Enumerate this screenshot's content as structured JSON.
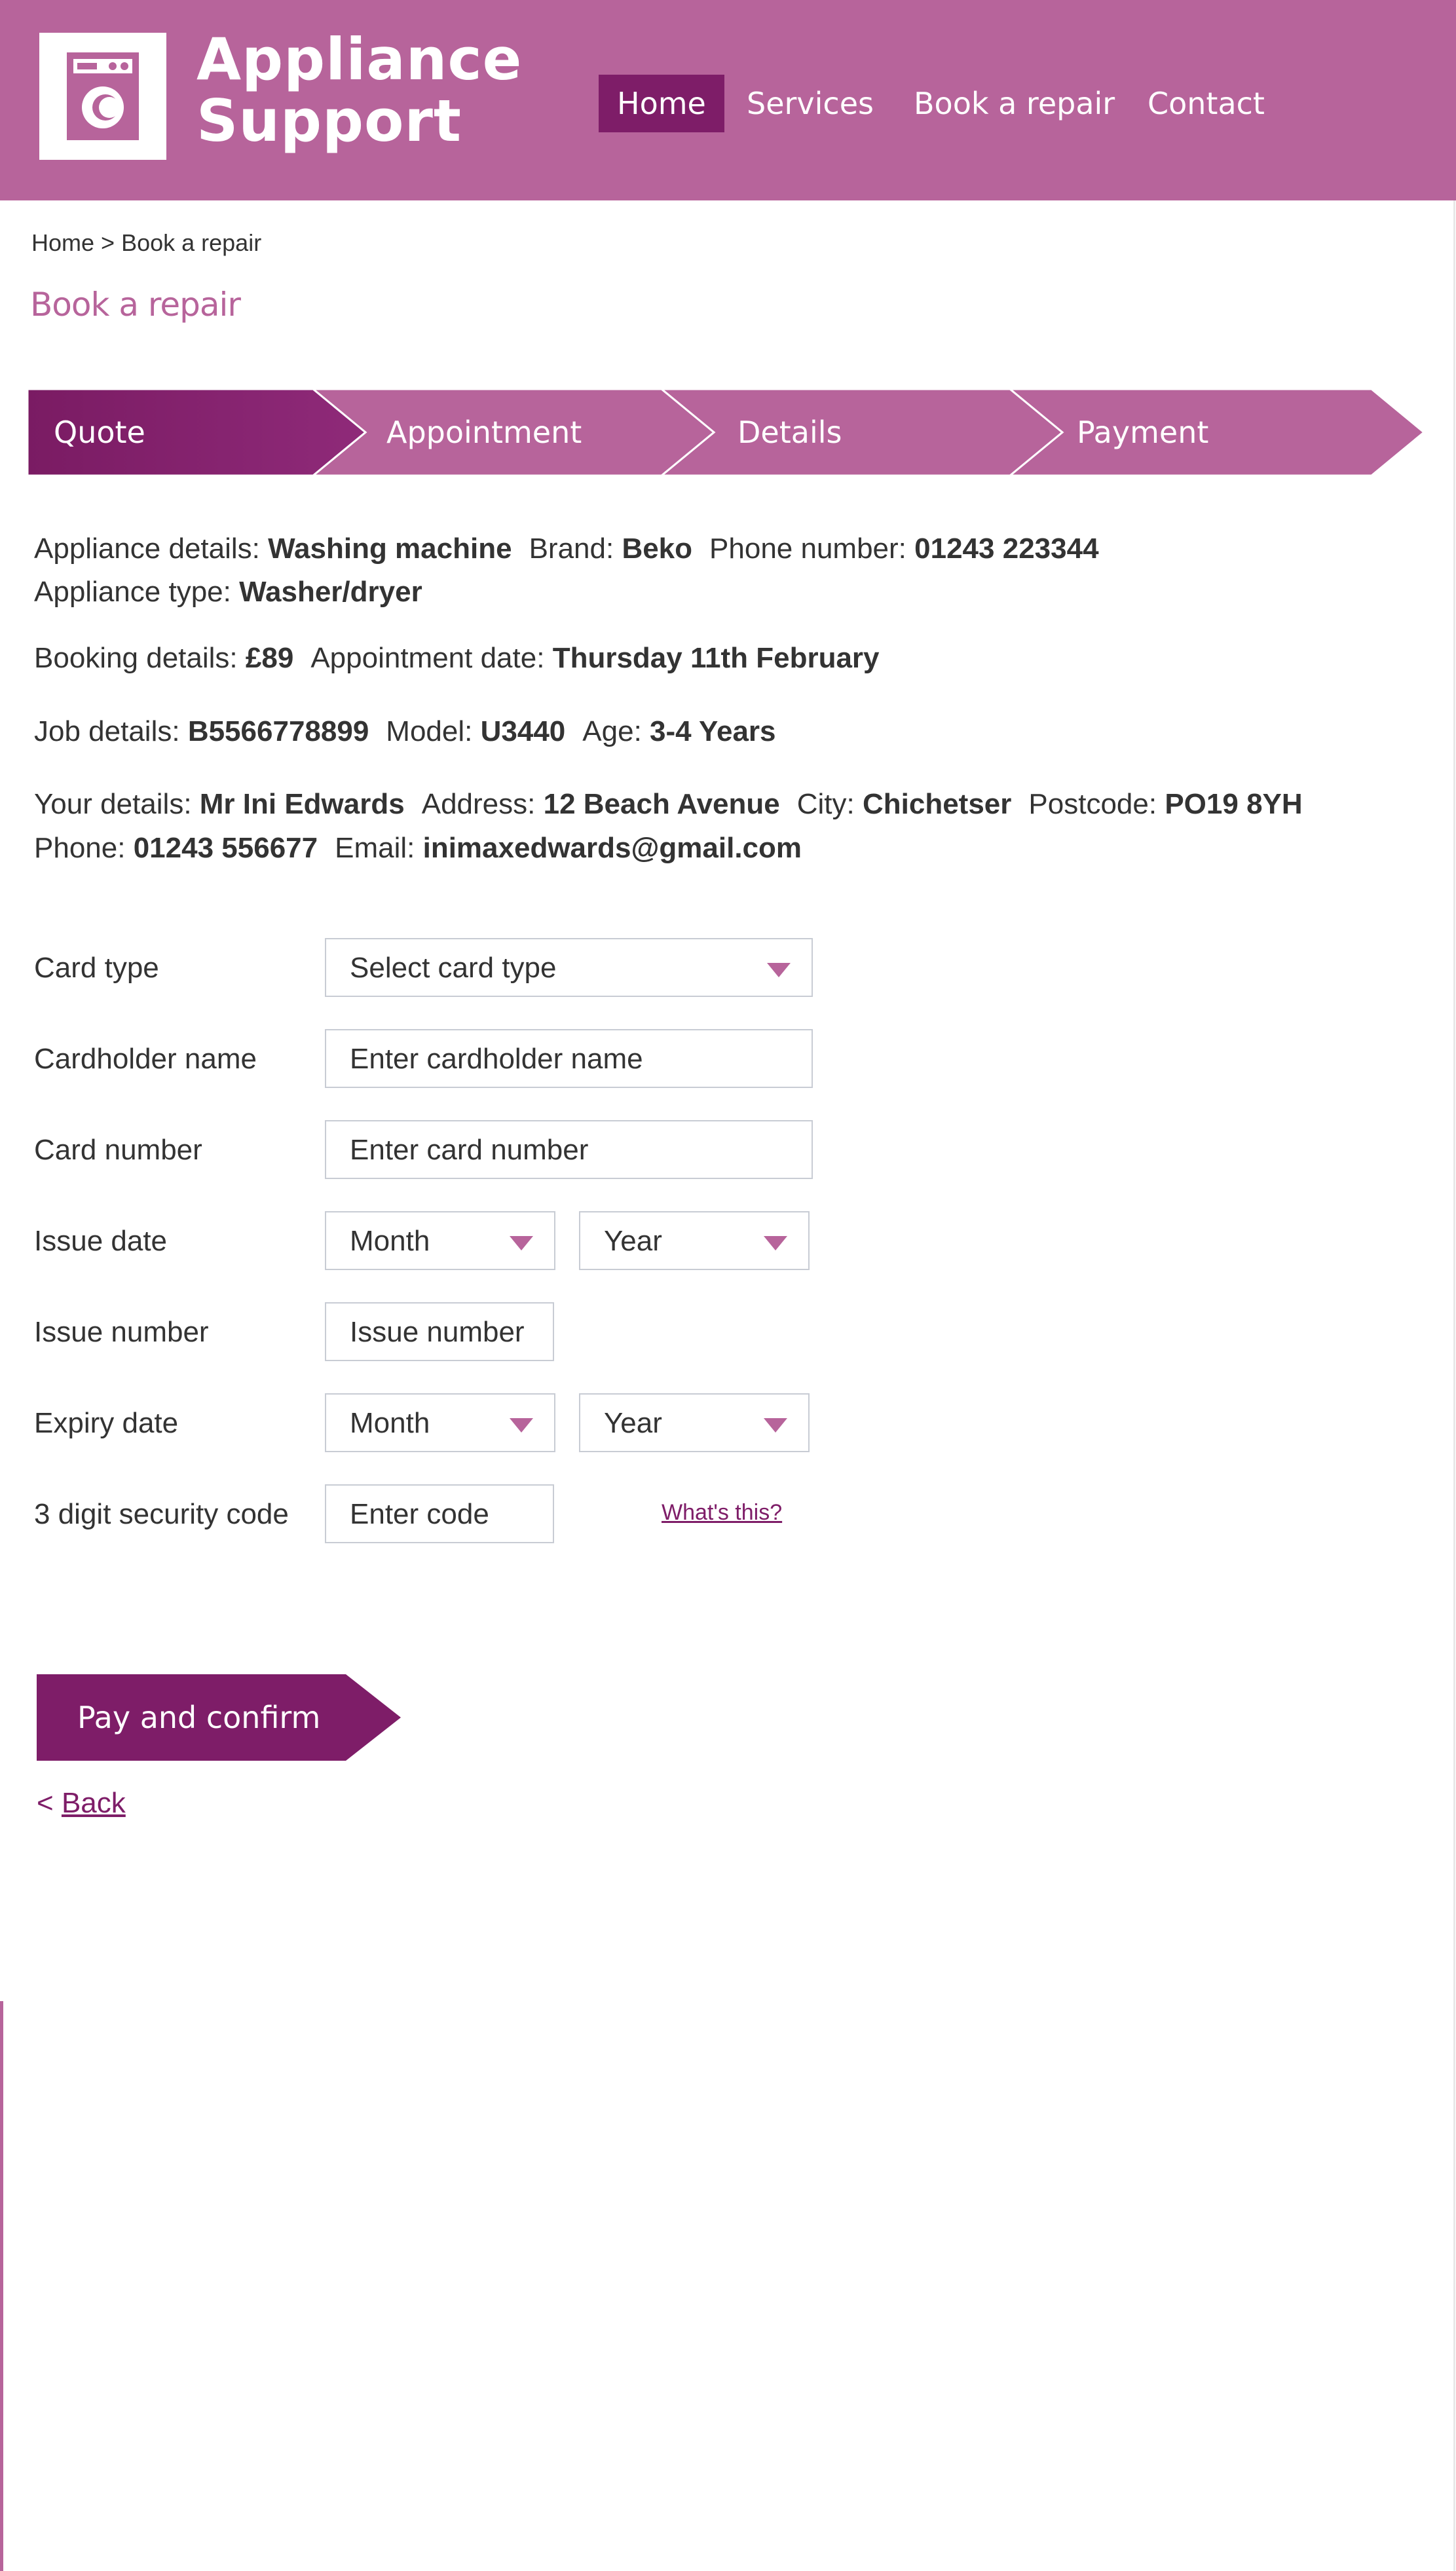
{
  "header": {
    "brand_line1": "Appliance",
    "brand_line2": "Support",
    "logo_icon": "washing-machine-icon",
    "nav": [
      "Home",
      "Services",
      "Book a repair",
      "Contact"
    ],
    "active_nav": "Home"
  },
  "breadcrumb": {
    "home": "Home",
    "separator": ">",
    "current": "Book a repair"
  },
  "page_title": "Book a repair",
  "steps": [
    "Quote",
    "Appointment",
    "Details",
    "Payment"
  ],
  "active_step": "Quote",
  "summary": {
    "appliance": {
      "label": "Appliance details:",
      "value": "Washing machine",
      "brand_label": "Brand:",
      "brand": "Beko",
      "phone_label": "Phone number:",
      "phone": "01243 223344",
      "type_label": "Appliance type:",
      "type": "Washer/dryer"
    },
    "booking": {
      "label": "Booking details:",
      "value": "£89",
      "date_label": "Appointment date:",
      "date": "Thursday 11th February"
    },
    "job": {
      "label": "Job details:",
      "value": "B5566778899",
      "model_label": "Model:",
      "model": "U3440",
      "age_label": "Age:",
      "age": "3-4 Years"
    },
    "you": {
      "label": "Your details:",
      "name": "Mr Ini Edwards",
      "address_label": "Address:",
      "address": "12 Beach Avenue",
      "city_label": "City:",
      "city": "Chichetser",
      "postcode_label": "Postcode:",
      "postcode": "PO19 8YH",
      "phone_label": "Phone:",
      "phone": "01243 556677",
      "email_label": "Email:",
      "email": "inimaxedwards@gmail.com"
    }
  },
  "form": {
    "card_type": {
      "label": "Card type",
      "value": "Select card type"
    },
    "cardholder": {
      "label": "Cardholder name",
      "placeholder": "Enter cardholder name"
    },
    "card_number": {
      "label": "Card number",
      "placeholder": "Enter card number"
    },
    "issue_date": {
      "label": "Issue date",
      "month": "Month",
      "year": "Year"
    },
    "issue_number": {
      "label": "Issue number",
      "placeholder": "Issue number"
    },
    "expiry_date": {
      "label": "Expiry date",
      "month": "Month",
      "year": "Year"
    },
    "security_code": {
      "label": "3 digit security code",
      "placeholder": "Enter code",
      "help": "What's this?"
    }
  },
  "actions": {
    "pay": "Pay and confirm",
    "back_prefix": "<",
    "back": "Back"
  },
  "colors": {
    "brand": "#b7649b",
    "brand_dark": "#7e1d68",
    "border": "#c8ccd4"
  }
}
